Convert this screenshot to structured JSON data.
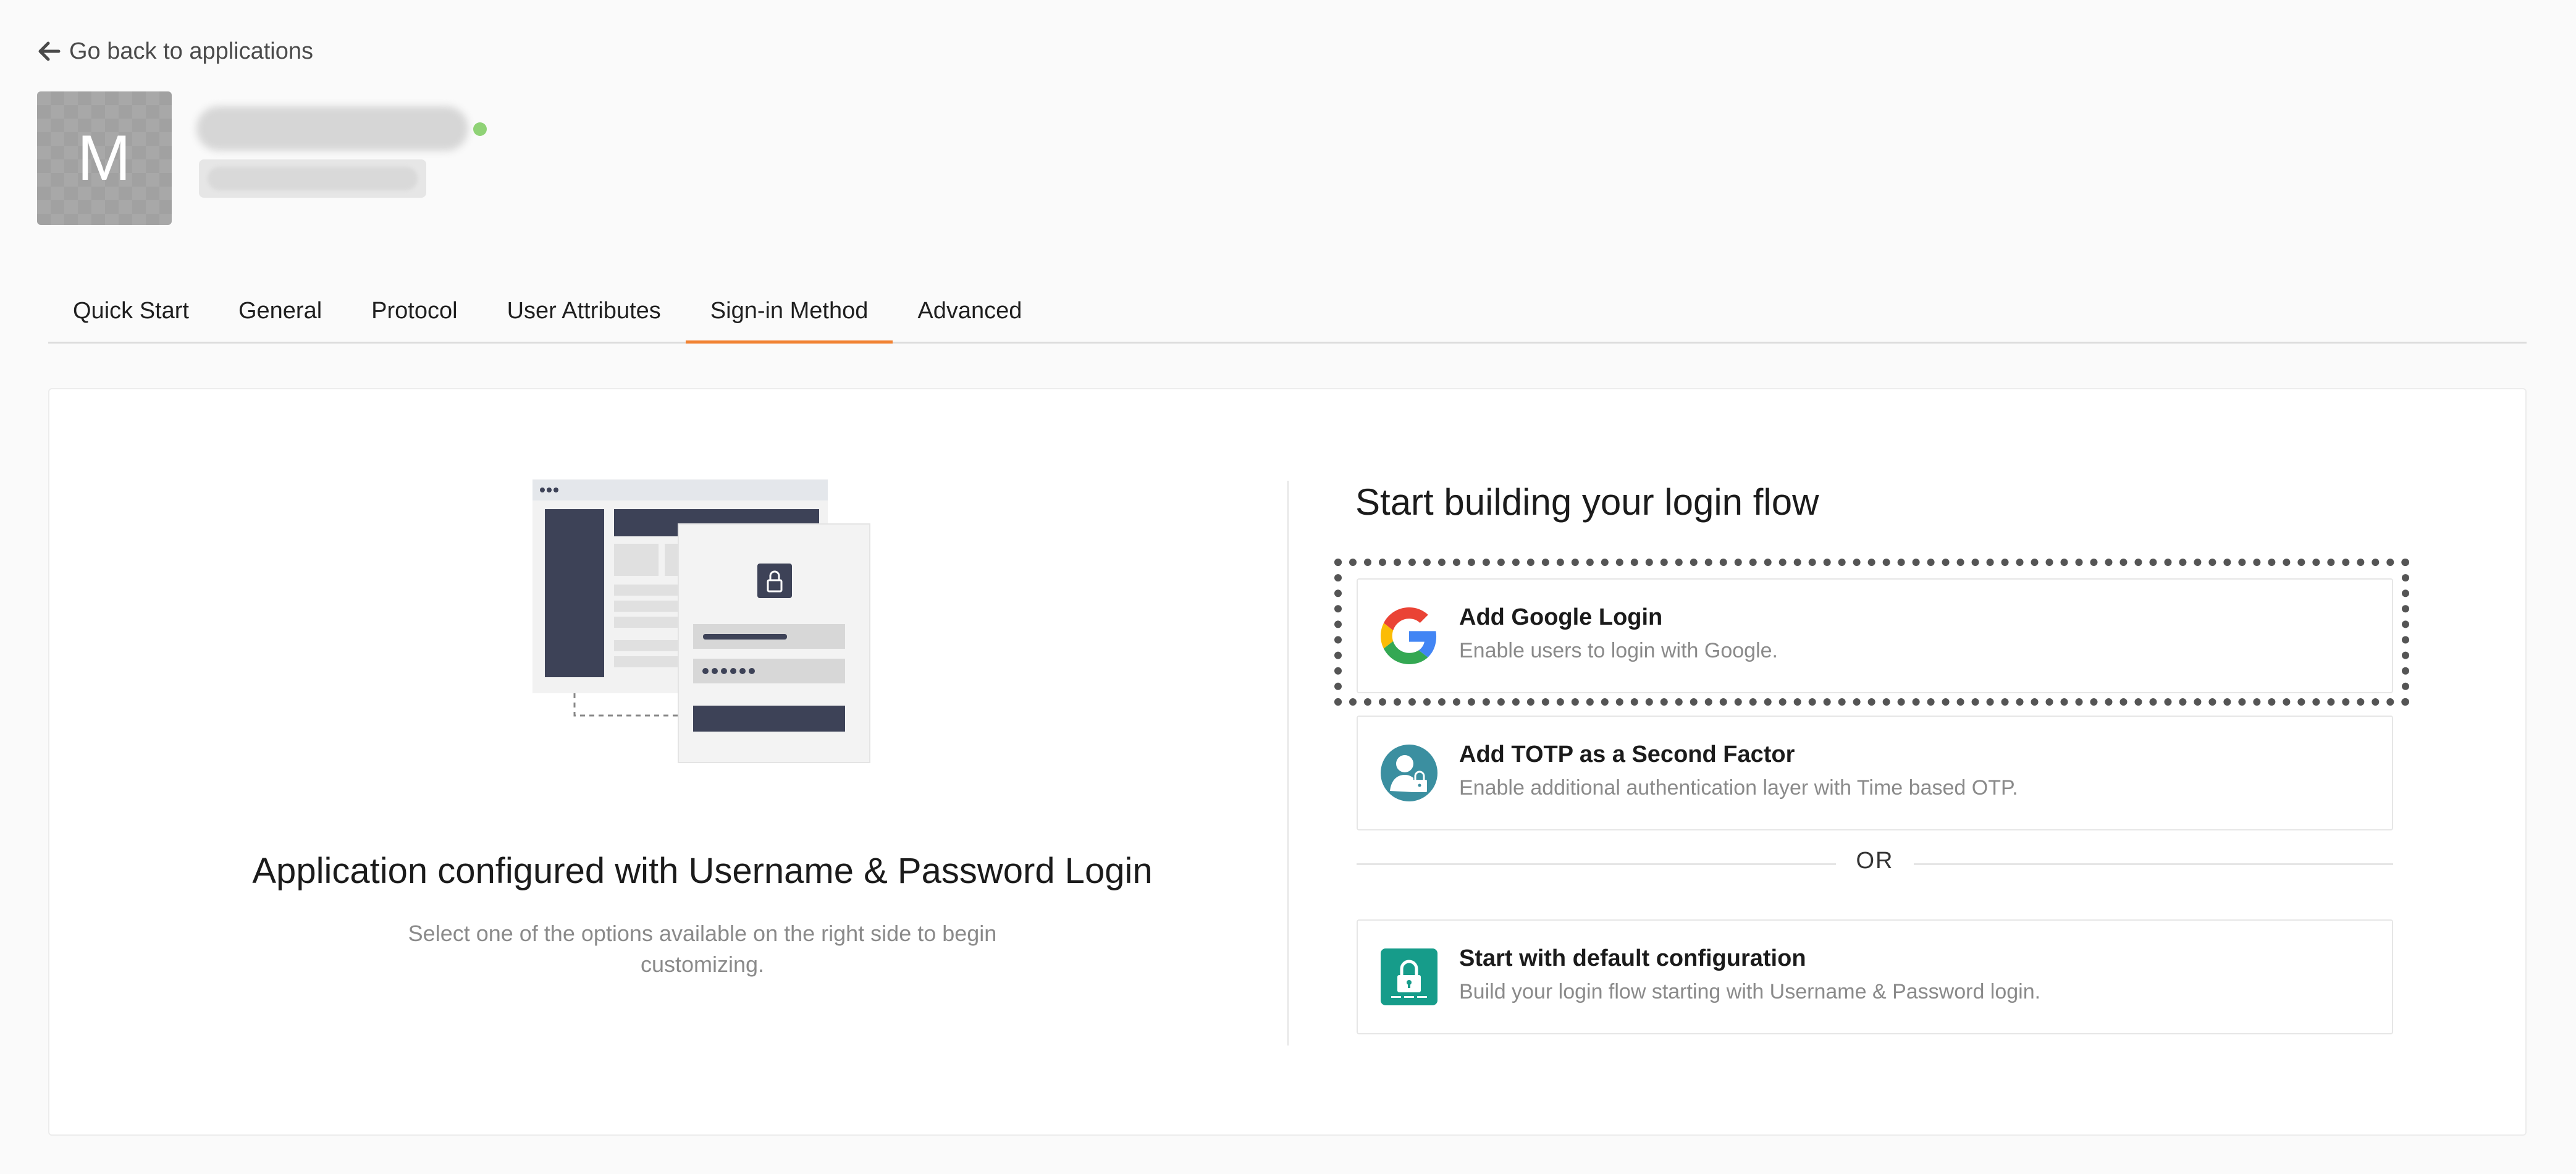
{
  "header": {
    "back_label": "Go back to applications",
    "avatar_letter": "M"
  },
  "tabs": [
    {
      "label": "Quick Start",
      "active": false
    },
    {
      "label": "General",
      "active": false
    },
    {
      "label": "Protocol",
      "active": false
    },
    {
      "label": "User Attributes",
      "active": false
    },
    {
      "label": "Sign-in Method",
      "active": true
    },
    {
      "label": "Advanced",
      "active": false
    }
  ],
  "left_panel": {
    "title": "Application configured with Username & Password Login",
    "description_line1": "Select one of the options available on the right side to begin",
    "description_line2": "customizing."
  },
  "right_panel": {
    "title": "Start building your login flow",
    "options": [
      {
        "title": "Add Google Login",
        "description": "Enable users to login with Google.",
        "icon": "google-logo-icon",
        "focused": true
      },
      {
        "title": "Add TOTP as a Second Factor",
        "description": "Enable additional authentication layer with Time based OTP.",
        "icon": "totp-user-lock-icon",
        "focused": false
      },
      {
        "title": "Start with default configuration",
        "description": "Build your login flow starting with Username & Password login.",
        "icon": "padlock-icon",
        "focused": false
      }
    ],
    "separator": "OR"
  },
  "colors": {
    "active_tab": "#f18232",
    "status_online": "#8fd276",
    "totp_icon": "#3b8fa0",
    "default_icon": "#169c8a",
    "illustration_dark": "#3d4257"
  }
}
